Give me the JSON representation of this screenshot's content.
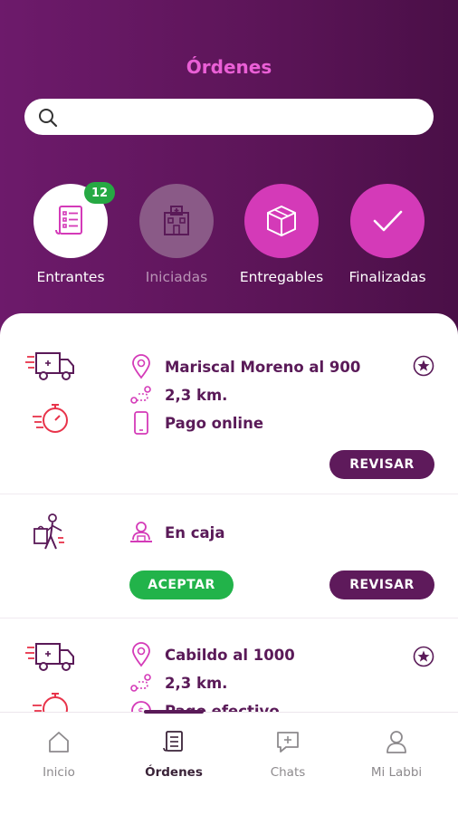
{
  "header": {
    "title": "Órdenes",
    "search_placeholder": ""
  },
  "statuses": [
    {
      "label": "Entrantes",
      "badge": "12",
      "icon": "document-list-icon",
      "state": "active"
    },
    {
      "label": "Iniciadas",
      "icon": "building-icon",
      "state": "disabled"
    },
    {
      "label": "Entregables",
      "icon": "box-icon",
      "state": "active"
    },
    {
      "label": "Finalizadas",
      "icon": "check-icon",
      "state": "active"
    }
  ],
  "orders": [
    {
      "type": "delivery-truck-icon",
      "address": "Mariscal Moreno al 900",
      "distance": "2,3 km.",
      "payment": "Pago online",
      "review_label": "REVISAR"
    },
    {
      "type": "person-with-bag-icon",
      "pickup": "En caja",
      "accept_label": "ACEPTAR",
      "review_label": "REVISAR"
    },
    {
      "type": "delivery-truck-icon",
      "address": "Cabildo al 1000",
      "distance": "2,3 km.",
      "payment": "Pago efectivo"
    }
  ],
  "nav": {
    "items": [
      {
        "label": "Inicio",
        "icon": "home-icon"
      },
      {
        "label": "Órdenes",
        "icon": "orders-icon",
        "active": true
      },
      {
        "label": "Chats",
        "icon": "chat-icon"
      },
      {
        "label": "Mi Labbi",
        "icon": "user-icon"
      }
    ]
  },
  "colors": {
    "header_bg": "#5d1559",
    "title_pink": "#ea5fd6",
    "magenta": "#d43ab8",
    "dark_purple": "#5e1a5b",
    "green": "#22b34a",
    "red_accent": "#e8334a"
  }
}
